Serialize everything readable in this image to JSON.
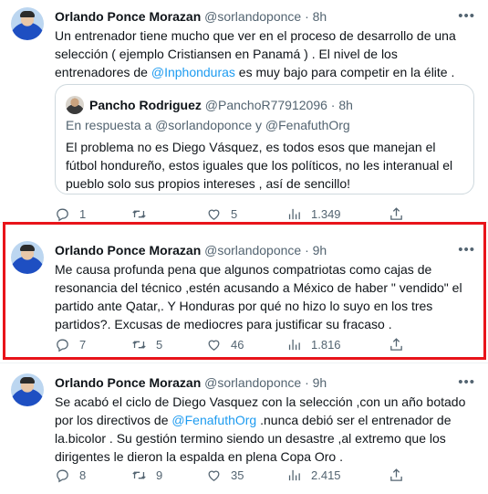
{
  "tweets": [
    {
      "name": "Orlando Ponce Morazan",
      "handle": "@sorlandoponce · 8h",
      "text_parts": [
        "Un entrenador tiene mucho que ver en el proceso de desarrollo de una selección ( ejemplo Cristiansen en Panamá ) . El nivel de los entrenadores de ",
        "@Inphonduras",
        "  es muy bajo para competir en la élite ."
      ],
      "quote": {
        "name": "Pancho Rodriguez",
        "handle": "@PanchoR77912096 · 8h",
        "reply_prefix": "En respuesta a ",
        "reply_to": "@sorlandoponce y @FenafuthOrg",
        "text": "El problema no es Diego Vásquez, es todos esos que manejan el fútbol hondureño, estos iguales que los políticos, no les interanual el pueblo solo sus propios intereses , así de sencillo!"
      },
      "replies": "1",
      "retweets": "",
      "likes": "5",
      "views": "1.349"
    },
    {
      "name": "Orlando Ponce Morazan",
      "handle": "@sorlandoponce · 9h",
      "text": "Me causa profunda  pena que algunos compatriotas como cajas de resonancia del técnico ,estén acusando a México de haber \" vendido\" el partido ante Qatar,. Y Honduras por qué no hizo lo suyo en los tres partidos?.  Excusas de mediocres para  justificar su fracaso .",
      "replies": "7",
      "retweets": "5",
      "likes": "46",
      "views": "1.816",
      "highlighted": true
    },
    {
      "name": "Orlando Ponce Morazan",
      "handle": "@sorlandoponce · 9h",
      "text_parts": [
        "Se acabó el ciclo de Diego Vasquez con la selección ,con un año botado por los  directivos de ",
        "@FenafuthOrg",
        "  .nunca debió ser el entrenador de la.bicolor . Su gestión termino siendo un desastre ,al extremo que los dirigentes le dieron la espalda en plena Copa Oro ."
      ],
      "replies": "8",
      "retweets": "9",
      "likes": "35",
      "views": "2.415"
    }
  ],
  "colors": {
    "accent": "#1d9bf0",
    "highlight_border": "#e8141a",
    "secondary_text": "#536471"
  },
  "icons": [
    "reply-icon",
    "retweet-icon",
    "like-icon",
    "views-icon",
    "share-icon",
    "more-icon"
  ]
}
